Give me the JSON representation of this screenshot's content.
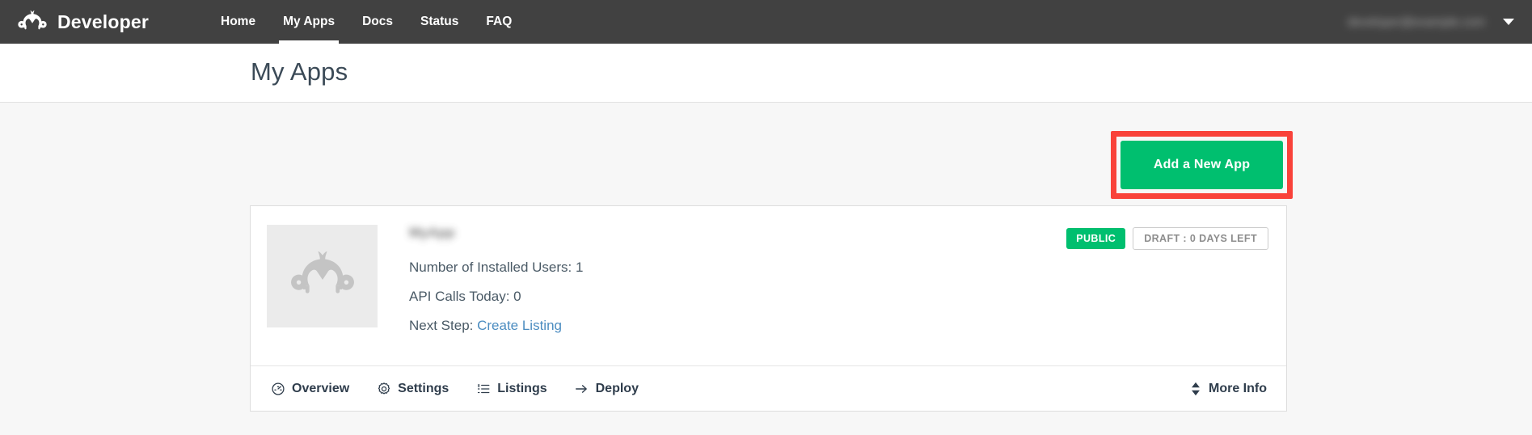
{
  "navbar": {
    "brand_label": "Developer",
    "brand_icon": "monkey-logo-icon",
    "links": [
      {
        "label": "Home",
        "active": false
      },
      {
        "label": "My Apps",
        "active": true
      },
      {
        "label": "Docs",
        "active": false
      },
      {
        "label": "Status",
        "active": false
      },
      {
        "label": "FAQ",
        "active": false
      }
    ],
    "account": {
      "email": "developer@example.com",
      "redacted": true,
      "caret_icon": "chevron-down-icon"
    },
    "background_color": "#414141"
  },
  "page": {
    "title": "My Apps"
  },
  "toolbar": {
    "add_app_label": "Add a New App",
    "add_app_color": "#00bf6f",
    "highlight_color": "#f9423a"
  },
  "app_card": {
    "thumbnail_icon": "monkey-placeholder-icon",
    "app_name": "MyApp",
    "app_name_redacted": true,
    "details": [
      {
        "label": "Number of Installed Users:",
        "value": "1"
      },
      {
        "label": "API Calls Today:",
        "value": "0"
      }
    ],
    "next_step": {
      "label": "Next Step:",
      "link_text": "Create Listing",
      "link_color": "#4b8cc0"
    },
    "badges": [
      {
        "text": "PUBLIC",
        "style": "solid",
        "color": "#00bf6f"
      },
      {
        "text": "DRAFT : 0 DAYS LEFT",
        "style": "outline",
        "color": "#8d8d8d"
      }
    ],
    "footer_actions": [
      {
        "label": "Overview",
        "icon": "gauge-icon"
      },
      {
        "label": "Settings",
        "icon": "gear-icon"
      },
      {
        "label": "Listings",
        "icon": "list-icon"
      },
      {
        "label": "Deploy",
        "icon": "arrow-right-icon"
      }
    ],
    "more_info": {
      "label": "More Info",
      "icon": "expand-updown-icon"
    }
  }
}
